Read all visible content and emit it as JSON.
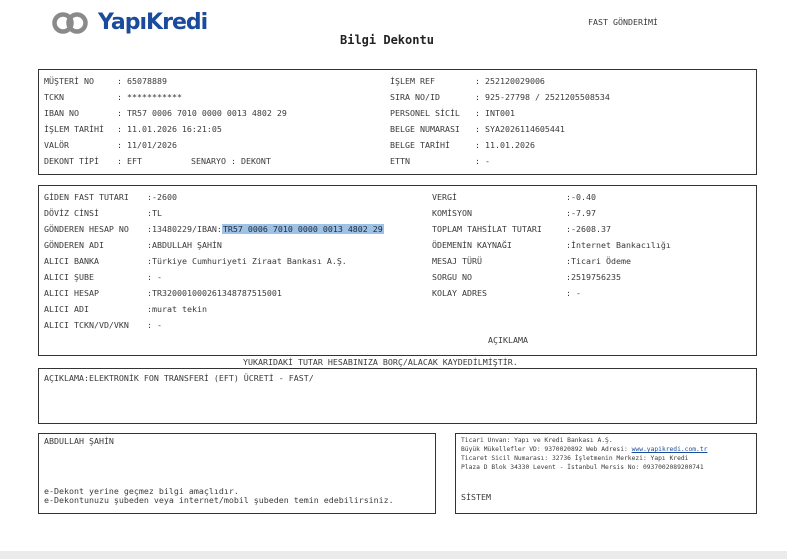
{
  "logo": {
    "text": "YapıKredi"
  },
  "doc_type": "FAST GÖNDERİMİ",
  "title": "Bilgi Dekontu",
  "customer": {
    "left": [
      {
        "label": "MÜŞTERİ NO",
        "value": ": 65078889"
      },
      {
        "label": "TCKN",
        "value": ": ***********"
      },
      {
        "label": "IBAN NO",
        "value": ": TR57 0006 7010 0000 0013 4802 29"
      },
      {
        "label": "İŞLEM TARİHİ",
        "value": ": 11.01.2026 16:21:05"
      },
      {
        "label": "VALÖR",
        "value": ": 11/01/2026"
      },
      {
        "label": "DEKONT TİPİ",
        "value": ": EFT"
      }
    ],
    "senaryo": "SENARYO  : DEKONT",
    "right": [
      {
        "label": "İŞLEM REF",
        "value": ": 252120029006"
      },
      {
        "label": "SIRA NO/ID",
        "value": ": 925-27798 / 2521205508534"
      },
      {
        "label": "PERSONEL SİCİL",
        "value": ": INT001"
      },
      {
        "label": "BELGE NUMARASI",
        "value": ": SYA2026114605441"
      },
      {
        "label": "BELGE TARİHİ",
        "value": ": 11.01.2026"
      },
      {
        "label": "ETTN",
        "value": ": -"
      }
    ]
  },
  "transfer": {
    "left": [
      {
        "label": "GİDEN FAST TUTARI",
        "value": ":-2600"
      },
      {
        "label": "DÖVİZ CİNSİ",
        "value": ":TL"
      },
      {
        "label": "GÖNDEREN HESAP NO",
        "value": ":13480229/IBAN:",
        "highlight": "TR57 0006 7010 0000 0013 4802 29"
      },
      {
        "label": "GÖNDEREN ADI",
        "value": ":ABDULLAH ŞAHİN"
      },
      {
        "label": "ALICI BANKA",
        "value": ":Türkiye Cumhuriyeti Ziraat Bankası A.Ş."
      },
      {
        "label": "ALICI ŞUBE",
        "value": ": -"
      },
      {
        "label": "ALICI HESAP",
        "value": ":TR320001000261348787515001"
      },
      {
        "label": "ALICI ADI",
        "value": ":murat tekin"
      },
      {
        "label": "ALICI TCKN/VD/VKN",
        "value": ": -"
      }
    ],
    "right": [
      {
        "label": "VERGİ",
        "value": ":-0.40"
      },
      {
        "label": "KOMİSYON",
        "value": ":-7.97"
      },
      {
        "label": "TOPLAM TAHSİLAT TUTARI",
        "value": ":-2608.37"
      },
      {
        "label": "ÖDEMENİN KAYNAĞI",
        "value": ":İnternet Bankacılığı"
      },
      {
        "label": "MESAJ TÜRÜ",
        "value": ":Ticari Ödeme"
      },
      {
        "label": "SORGU NO",
        "value": ":2519756235"
      },
      {
        "label": "KOLAY ADRES",
        "value": ": -"
      }
    ],
    "aciklama_header": "AÇIKLAMA"
  },
  "notice": "YUKARIDAKİ TUTAR HESABINIZA BORÇ/ALACAK KAYDEDİLMİŞTİR.",
  "description": "AÇIKLAMA:ELEKTRONİK FON TRANSFERİ (EFT) ÜCRETİ - FAST/",
  "footer_left": {
    "name": "ABDULLAH ŞAHİN",
    "line1": "e-Dekont yerine geçmez bilgi amaçlıdır.",
    "line2": "e-Dekontunuzu şubeden veya internet/mobil şubeden temin edebilirsiniz."
  },
  "footer_right": {
    "line1": "Ticari Unvan: Yapı ve Kredi Bankası A.Ş.",
    "line2_prefix": "Büyük Mükellefler VD: 9370020892 Web Adresi: ",
    "line2_link": "www.yapikredi.com.tr",
    "line3": "Ticaret Sicil Numarası: 32736 İşletmenin Merkezi: Yapı Kredi",
    "line4": "Plaza D Blok 34330 Levent - İstanbul Mersis No: 0937002089200741",
    "system": "SİSTEM"
  }
}
